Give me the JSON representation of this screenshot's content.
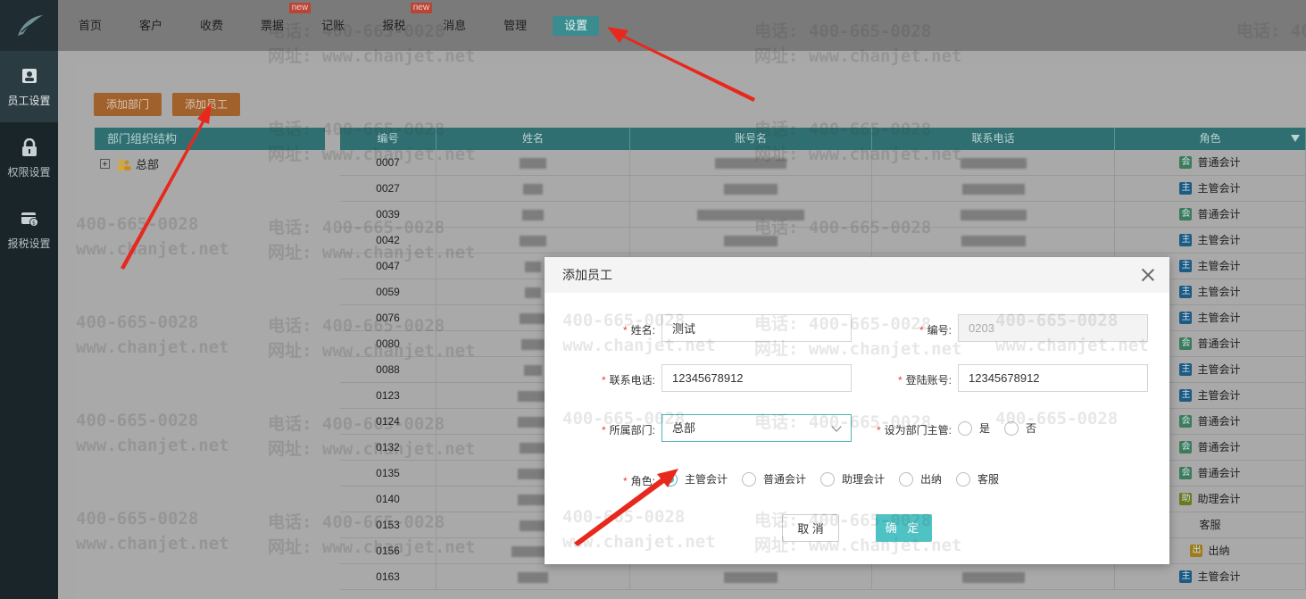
{
  "sidebar": {
    "items": [
      {
        "label": "员工设置",
        "icon": "id-badge-icon"
      },
      {
        "label": "权限设置",
        "icon": "lock-icon"
      },
      {
        "label": "报税设置",
        "icon": "tax-card-icon"
      }
    ]
  },
  "topnav": {
    "items": [
      {
        "label": "首页"
      },
      {
        "label": "客户"
      },
      {
        "label": "收费"
      },
      {
        "label": "票据",
        "badge": "new"
      },
      {
        "label": "记账"
      },
      {
        "label": "报税",
        "badge": "new"
      },
      {
        "label": "消息"
      },
      {
        "label": "管理"
      },
      {
        "label": "设置"
      }
    ]
  },
  "toolbar": {
    "add_dept": "添加部门",
    "add_employee": "添加员工"
  },
  "tree": {
    "header": "部门组织结构",
    "root": "总部"
  },
  "table": {
    "headers": {
      "id": "编号",
      "name": "姓名",
      "account": "账号名",
      "phone": "联系电话",
      "role": "角色"
    },
    "rows": [
      {
        "id": "0007",
        "role": "普通会计",
        "tag": "会"
      },
      {
        "id": "0027",
        "role": "主管会计",
        "tag": "主"
      },
      {
        "id": "0039",
        "role": "普通会计",
        "tag": "会"
      },
      {
        "id": "0042",
        "role": "主管会计",
        "tag": "主"
      },
      {
        "id": "0047",
        "role": "主管会计",
        "tag": "主"
      },
      {
        "id": "0059",
        "role": "主管会计",
        "tag": "主"
      },
      {
        "id": "0076",
        "role": "主管会计",
        "tag": "主"
      },
      {
        "id": "0080",
        "role": "普通会计",
        "tag": "会"
      },
      {
        "id": "0088",
        "role": "主管会计",
        "tag": "主"
      },
      {
        "id": "0123",
        "role": "主管会计",
        "tag": "主"
      },
      {
        "id": "0124",
        "role": "普通会计",
        "tag": "会"
      },
      {
        "id": "0132",
        "role": "普通会计",
        "tag": "会"
      },
      {
        "id": "0135",
        "role": "普通会计",
        "tag": "会"
      },
      {
        "id": "0140",
        "role": "助理会计",
        "tag": "助"
      },
      {
        "id": "0153",
        "role": "客服",
        "tag": ""
      },
      {
        "id": "0156",
        "role": "出纳",
        "tag": "出"
      },
      {
        "id": "0163",
        "role": "主管会计",
        "tag": "主"
      }
    ]
  },
  "watermark": {
    "phone": "电话: 400-665-0028",
    "phone_short": "400-665-0028",
    "site": "网址: www.chanjet.net",
    "site_short": "www.chanjet.net"
  },
  "modal": {
    "title": "添加员工",
    "fields": {
      "name": {
        "label": "姓名:",
        "value": "测试"
      },
      "number": {
        "label": "编号:",
        "value": "0203"
      },
      "phone": {
        "label": "联系电话:",
        "value": "12345678912"
      },
      "login": {
        "label": "登陆账号:",
        "value": "12345678912"
      },
      "dept": {
        "label": "所属部门:",
        "value": "总部"
      },
      "manager": {
        "label": "设为部门主管:",
        "yes": "是",
        "no": "否"
      },
      "role": {
        "label": "角色:",
        "options": [
          "主管会计",
          "普通会计",
          "助理会计",
          "出纳",
          "客服"
        ],
        "selected": "主管会计"
      }
    },
    "cancel": "取 消",
    "ok": "确 定"
  }
}
